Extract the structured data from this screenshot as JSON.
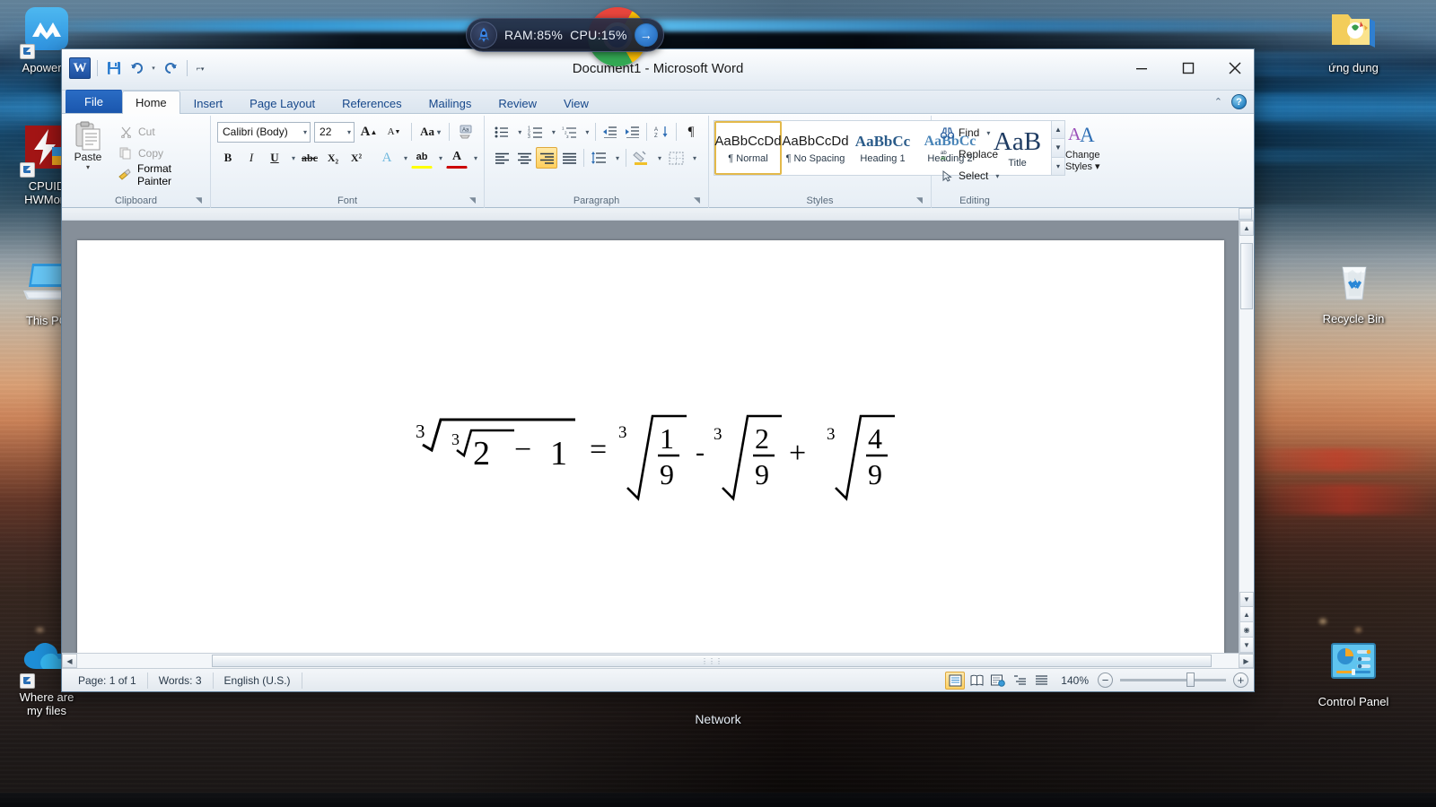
{
  "desktop": {
    "icons_left": [
      {
        "name": "ApowerMirror",
        "label": "ApowerM",
        "shortcut": true
      },
      {
        "name": "CPUID HWMonitor",
        "label": "CPUID\nHWMoni",
        "shortcut": true
      },
      {
        "name": "This PC",
        "label": "This PC",
        "shortcut": false
      },
      {
        "name": "Where are my files",
        "label": "Where are\nmy files",
        "shortcut": true
      }
    ],
    "icons_right": [
      {
        "name": "ung dung folder",
        "label": "ứng dụng",
        "shortcut": false
      },
      {
        "name": "Recycle Bin",
        "label": "Recycle Bin",
        "shortcut": false
      },
      {
        "name": "Control Panel",
        "label": "Control Panel",
        "shortcut": false
      }
    ],
    "taskbar_label": "Network"
  },
  "widget": {
    "ram_label": "RAM:85%",
    "cpu_label": "CPU:15%",
    "arrow": "→",
    "rocket": "🚀"
  },
  "window": {
    "title": "Document1  -  Microsoft Word",
    "quick_access": [
      {
        "name": "save",
        "label": "💾"
      },
      {
        "name": "undo",
        "label": "↺"
      },
      {
        "name": "redo",
        "label": "↻"
      },
      {
        "name": "customize",
        "label": "⌄"
      }
    ],
    "controls": {
      "minimize": "—",
      "maximize": "▢",
      "close": "✕"
    },
    "logo_text": "W"
  },
  "tabs": [
    {
      "label": "File",
      "active": false,
      "kind": "file"
    },
    {
      "label": "Home",
      "active": true
    },
    {
      "label": "Insert",
      "active": false
    },
    {
      "label": "Page Layout",
      "active": false
    },
    {
      "label": "References",
      "active": false
    },
    {
      "label": "Mailings",
      "active": false
    },
    {
      "label": "Review",
      "active": false
    },
    {
      "label": "View",
      "active": false
    }
  ],
  "tab_right": {
    "collapse_ribbon": "⌃",
    "help": "?"
  },
  "ribbon": {
    "clipboard": {
      "title": "Clipboard",
      "paste_label": "Paste",
      "paste_arrow": "▾",
      "items": [
        {
          "name": "cut",
          "label": "Cut",
          "disabled": true
        },
        {
          "name": "copy",
          "label": "Copy",
          "disabled": true
        },
        {
          "name": "format-painter",
          "label": "Format Painter",
          "disabled": false
        }
      ]
    },
    "font": {
      "title": "Font",
      "font_name": "Calibri (Body)",
      "font_size": "22",
      "grow_font": "A",
      "shrink_font": "A",
      "change_case": "Aa",
      "clear_formatting": "A",
      "bold": "B",
      "italic": "I",
      "underline": "U",
      "strikethrough": "abc",
      "subscript": "X₂",
      "superscript": "X²",
      "text_effects": "A",
      "highlight": "ab",
      "font_color": "A"
    },
    "paragraph": {
      "title": "Paragraph",
      "bullets": "•≡",
      "numbering": "1≡",
      "multilevel": "≡",
      "decrease_indent": "◄≡",
      "increase_indent": "►≡",
      "sort": "A↓",
      "show_marks": "¶",
      "align_left": "≡",
      "align_center": "≡",
      "align_right": "≡",
      "justify": "≡",
      "line_spacing": "↕≡",
      "shading": "▣",
      "borders": "▦"
    },
    "styles": {
      "title": "Styles",
      "gallery": [
        {
          "sample": "AaBbCcDd",
          "name": "¶ Normal",
          "kind": "normal",
          "selected": true
        },
        {
          "sample": "AaBbCcDd",
          "name": "¶ No Spacing",
          "kind": "normal",
          "selected": false
        },
        {
          "sample": "AaBbCc",
          "name": "Heading 1",
          "kind": "h1",
          "selected": false
        },
        {
          "sample": "AaBbCc",
          "name": "Heading 2",
          "kind": "h2",
          "selected": false
        },
        {
          "sample": "AaB",
          "name": "Title",
          "kind": "title",
          "selected": false
        }
      ],
      "change_styles_line1": "Change",
      "change_styles_line2": "Styles",
      "change_styles_arrow": "▾"
    },
    "editing": {
      "title": "Editing",
      "items": [
        {
          "name": "find",
          "label": "Find",
          "arrow": "▾"
        },
        {
          "name": "replace",
          "label": "Replace",
          "arrow": ""
        },
        {
          "name": "select",
          "label": "Select",
          "arrow": "▾"
        }
      ]
    }
  },
  "document": {
    "equation_text": "∛(∛2 − 1) = ∛(1/9) − ∛(2/9) + ∛(4/9)",
    "equation": {
      "lhs": {
        "index": "3",
        "radicand_index": "3",
        "radicand_value": "2",
        "minus": "−",
        "one": "1"
      },
      "equals": "=",
      "terms": [
        {
          "op": "",
          "index": "3",
          "numerator": "1",
          "denominator": "9"
        },
        {
          "op": "-",
          "index": "3",
          "numerator": "2",
          "denominator": "9"
        },
        {
          "op": "+",
          "index": "3",
          "numerator": "4",
          "denominator": "9"
        }
      ]
    }
  },
  "status": {
    "page": "Page: 1 of 1",
    "words": "Words: 3",
    "language": "English (U.S.)",
    "zoom": "140%",
    "zoom_out": "−",
    "zoom_in": "+",
    "views": [
      {
        "name": "print-layout",
        "glyph": "▤",
        "selected": true
      },
      {
        "name": "full-screen-reading",
        "glyph": "▥",
        "selected": false
      },
      {
        "name": "web-layout",
        "glyph": "▣",
        "selected": false
      },
      {
        "name": "outline",
        "glyph": "▤",
        "selected": false
      },
      {
        "name": "draft",
        "glyph": "▤",
        "selected": false
      }
    ]
  },
  "colors": {
    "accent_blue": "#1a56ad",
    "ribbon_bg": "#eff4f9",
    "style_select": "#e3b94a",
    "highlight_yellow": "#ffff00",
    "font_color_red": "#cc0000"
  }
}
